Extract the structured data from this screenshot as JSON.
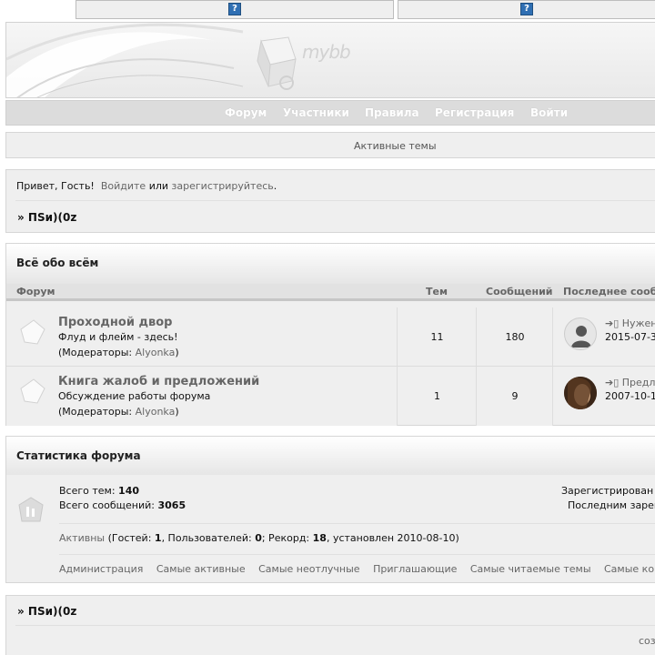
{
  "top": {
    "help_left": "?",
    "help_right": "?"
  },
  "header": {
    "logo_text": "mybb"
  },
  "nav": {
    "items": [
      "Форум",
      "Участники",
      "Правила",
      "Регистрация",
      "Войти"
    ]
  },
  "active_topics": "Активные темы",
  "welcome": {
    "greeting": "Привет, Гость!",
    "login": "Войдите",
    "or": "или",
    "register": "зарегистрируйтесь",
    "period": "."
  },
  "breadcrumb": "» ПSи)(0z",
  "category": {
    "title": "Всё обо всём"
  },
  "columns": {
    "forum": "Форум",
    "topics": "Тем",
    "posts": "Сообщений",
    "last": "Последнее сооб"
  },
  "forums": [
    {
      "title": "Проходной двор",
      "desc": "Флуд и флейм - здесь!",
      "mod_prefix": "(Модераторы: ",
      "mod": "Alyonka",
      "mod_suffix": ")",
      "topics": "11",
      "posts": "180",
      "last_title": "Нужен",
      "last_date": "2015-07-3"
    },
    {
      "title": "Книга жалоб и предложений",
      "desc": "Обсуждение работы форума",
      "mod_prefix": "(Модераторы: ",
      "mod": "Alyonka",
      "mod_suffix": ")",
      "topics": "1",
      "posts": "9",
      "last_title": "Предл",
      "last_date": "2007-10-1"
    }
  ],
  "stats": {
    "title": "Статистика форума",
    "topics_label": "Всего тем: ",
    "topics_value": "140",
    "posts_label": "Всего сообщений: ",
    "posts_value": "3065",
    "registered": "Зарегистрирован",
    "last_registered": "Последним зарег",
    "active_link": "Активны",
    "active_text_1": " (Гостей: ",
    "guests": "1",
    "active_text_2": ", Пользователей: ",
    "users": "0",
    "active_text_3": "; Рекорд: ",
    "record": "18",
    "active_text_4": ", установлен 2010-08-10)",
    "links": [
      "Администрация",
      "Самые активные",
      "Самые неотлучные",
      "Приглашающие",
      "Самые читаемые темы",
      "Самые ко"
    ]
  },
  "footer": {
    "breadcrumb": "» ПSи)(0z",
    "created": "соз"
  }
}
